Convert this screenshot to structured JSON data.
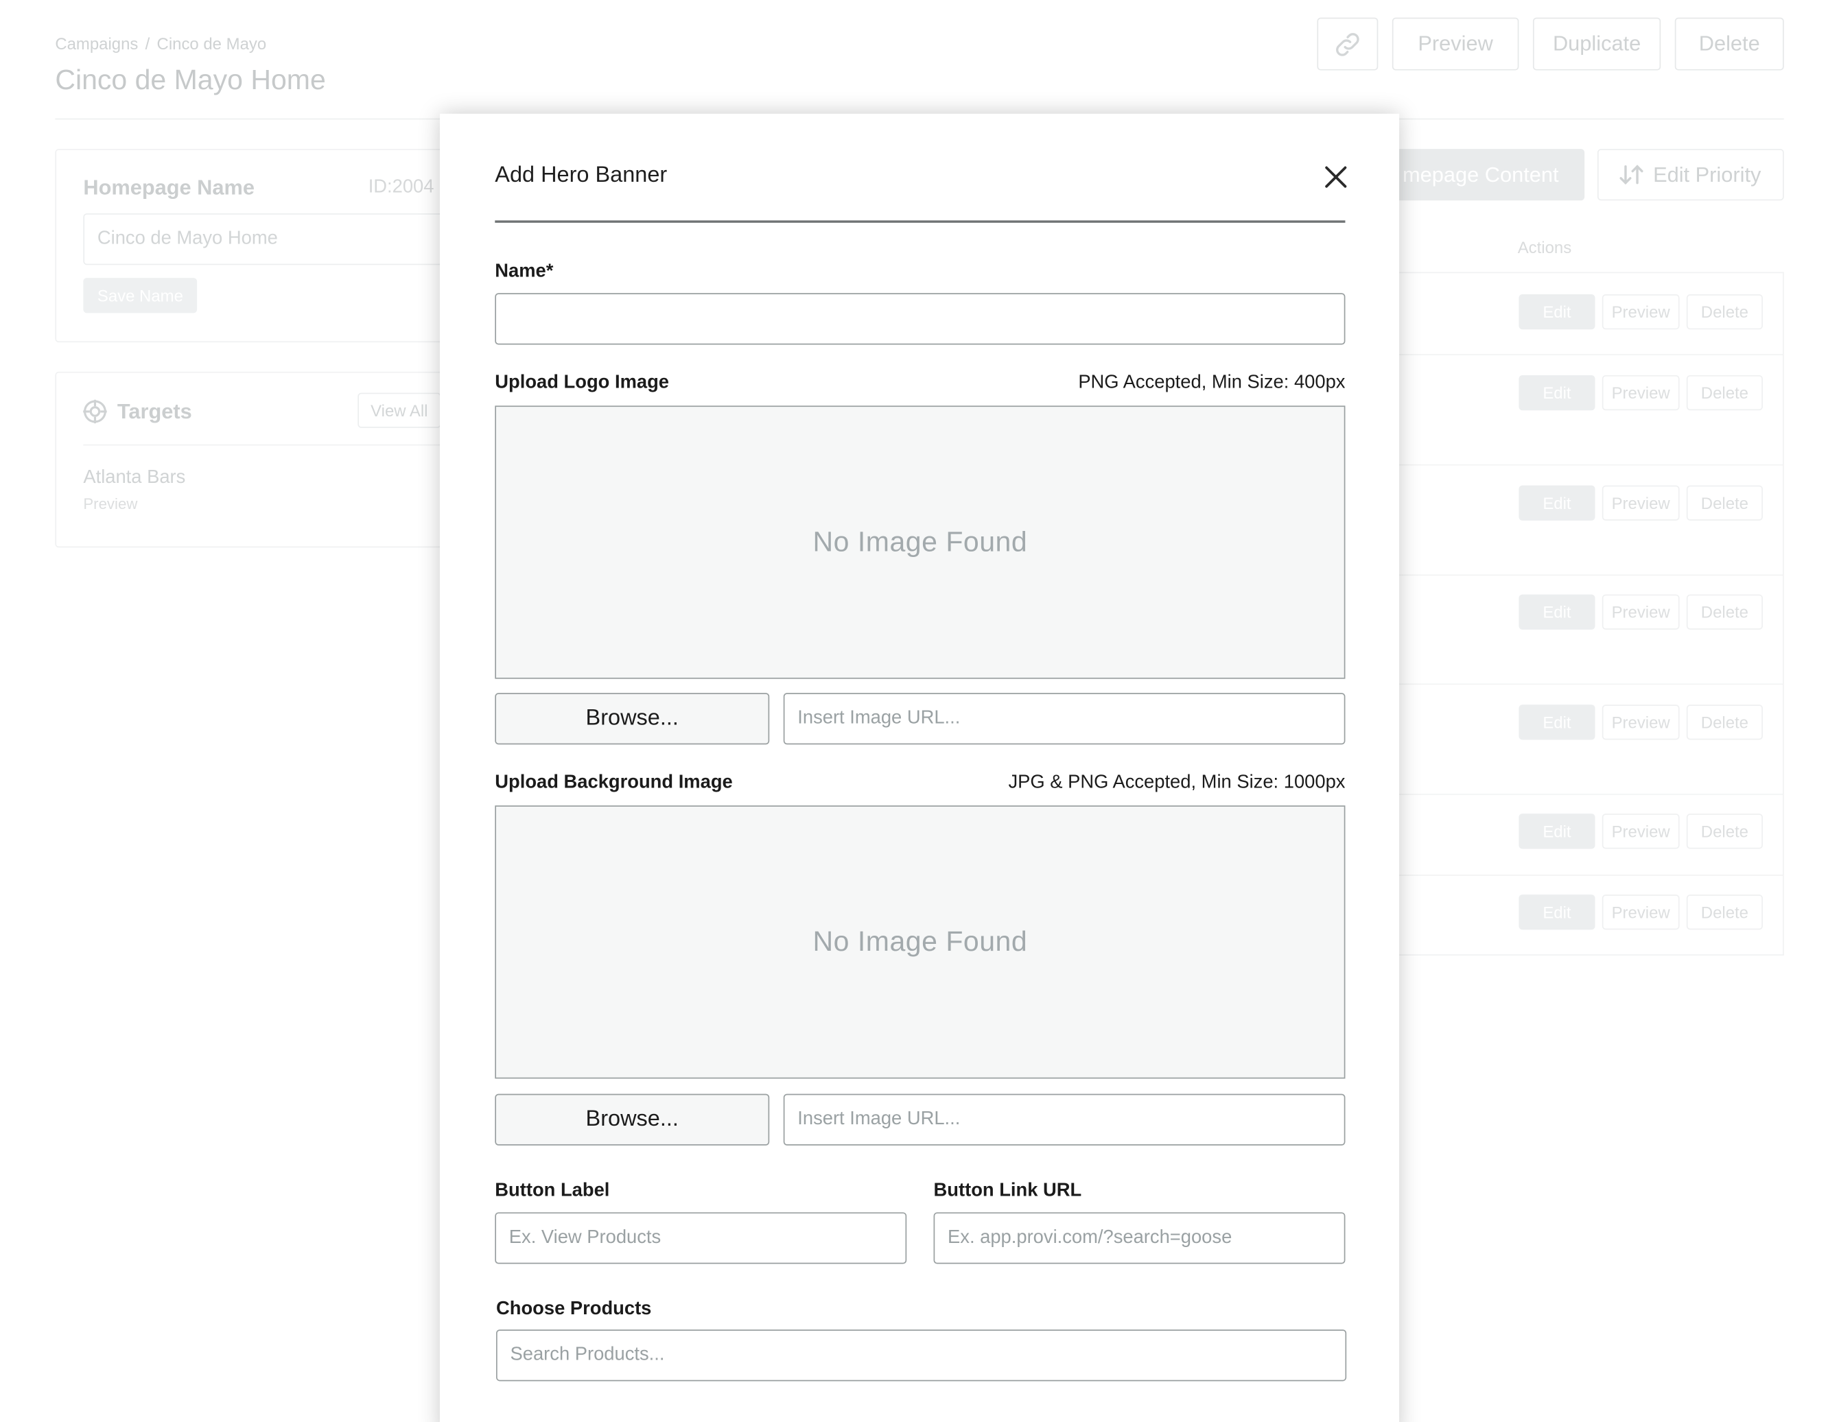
{
  "background": {
    "breadcrumb": {
      "root": "Campaigns",
      "separator": "/",
      "current": "Cinco de Mayo"
    },
    "page_title": "Cinco de Mayo Home",
    "top_actions": {
      "preview": "Preview",
      "duplicate": "Duplicate",
      "delete": "Delete"
    },
    "name_card": {
      "label": "Homepage Name",
      "id": "ID:2004",
      "value": "Cinco de Mayo Home",
      "save": "Save Name"
    },
    "targets_card": {
      "label": "Targets",
      "view_all": "View All",
      "target_name": "Atlanta Bars",
      "target_sub": "Preview"
    },
    "homepage_content_btn": "mepage Content",
    "edit_priority_btn": "Edit Priority",
    "actions_header": "Actions",
    "row_labels": {
      "edit": "Edit",
      "preview": "Preview",
      "delete": "Delete"
    }
  },
  "modal": {
    "title": "Add Hero Banner",
    "name_label": "Name*",
    "name_value": "",
    "logo": {
      "label": "Upload Logo Image",
      "hint": "PNG Accepted, Min Size: 400px",
      "empty_text": "No Image Found",
      "browse": "Browse...",
      "url_placeholder": "Insert Image URL..."
    },
    "background": {
      "label": "Upload Background Image",
      "hint": "JPG & PNG Accepted, Min Size: 1000px",
      "empty_text": "No Image Found",
      "browse": "Browse...",
      "url_placeholder": "Insert Image URL..."
    },
    "button_label": {
      "label": "Button Label",
      "placeholder": "Ex. View Products"
    },
    "button_link": {
      "label": "Button Link URL",
      "placeholder": "Ex. app.provi.com/?search=goose"
    },
    "products": {
      "label": "Choose Products",
      "placeholder": "Search Products..."
    }
  }
}
